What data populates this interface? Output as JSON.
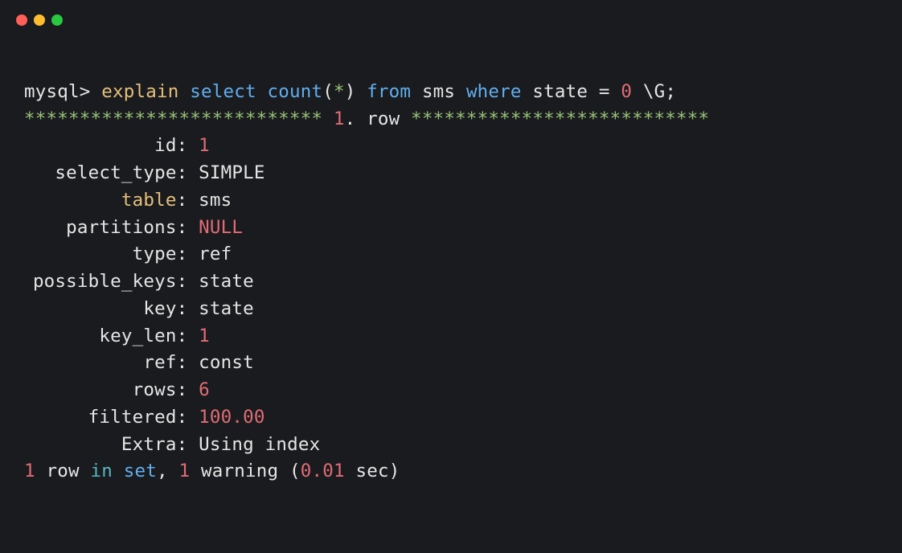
{
  "prompt": "mysql> ",
  "cmd": {
    "explain": "explain",
    "select": "select",
    "count": "count",
    "lparen": "(",
    "star": "*",
    "rparen": ")",
    "from": "from",
    "table": "sms",
    "where": "where",
    "col": "state",
    "eq": " = ",
    "val": "0",
    "tail": " \\G;"
  },
  "divider": {
    "stars_left": "***************************",
    "rownum": " 1",
    "dot_row": ". row ",
    "stars_right": "***************************"
  },
  "fields": {
    "id": {
      "label": "id",
      "value": "1"
    },
    "select_type": {
      "label": "select_type",
      "value": "SIMPLE"
    },
    "table": {
      "label": "table",
      "value": "sms"
    },
    "partitions": {
      "label": "partitions",
      "value": "NULL"
    },
    "type": {
      "label": "type",
      "value": "ref"
    },
    "possible_keys": {
      "label": "possible_keys",
      "value": "state"
    },
    "key": {
      "label": "key",
      "value": "state"
    },
    "key_len": {
      "label": "key_len",
      "value": "1"
    },
    "ref": {
      "label": "ref",
      "value": "const"
    },
    "rows": {
      "label": "rows",
      "value": "6"
    },
    "filtered": {
      "label": "filtered",
      "value": "100.00"
    },
    "extra": {
      "label": "Extra",
      "value": "Using index"
    }
  },
  "footer": {
    "one1": "1",
    "row_text": " row ",
    "in": "in",
    "space1": " ",
    "set": "set",
    "comma": ", ",
    "one2": "1",
    "warning": " warning (",
    "time": "0.01",
    "sec": " sec)"
  },
  "sep": ": "
}
